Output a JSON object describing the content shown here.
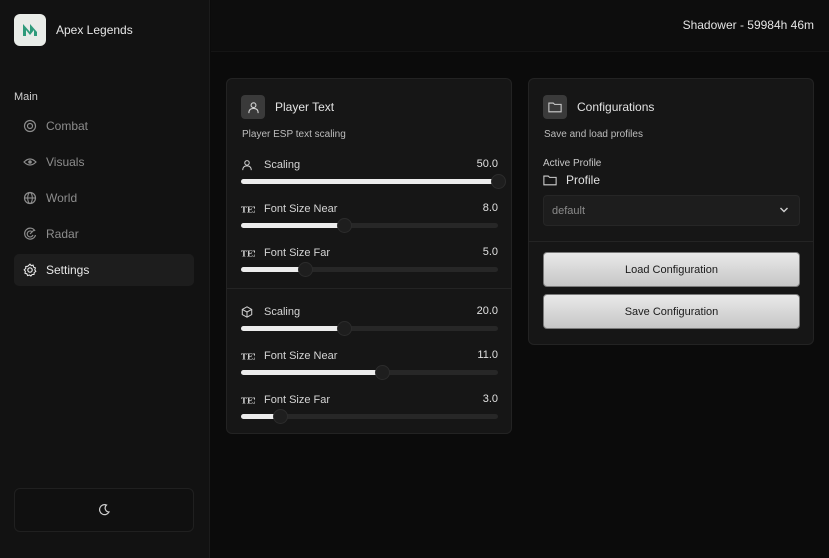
{
  "app": {
    "title": "Apex Legends"
  },
  "user_status": "Shadower - 59984h 46m",
  "sidebar": {
    "section_label": "Main",
    "items": [
      {
        "label": "Combat",
        "icon": "target-icon",
        "active": false
      },
      {
        "label": "Visuals",
        "icon": "eye-icon",
        "active": false
      },
      {
        "label": "World",
        "icon": "globe-icon",
        "active": false
      },
      {
        "label": "Radar",
        "icon": "radar-icon",
        "active": false
      },
      {
        "label": "Settings",
        "icon": "gear-icon",
        "active": true
      }
    ],
    "theme_toggle_icon": "moon-icon"
  },
  "player_text": {
    "title": "Player Text",
    "subtitle": "Player ESP text scaling",
    "groups": [
      {
        "icon": "user-icon",
        "sliders": [
          {
            "label": "Scaling",
            "value": "50.0",
            "fraction": 1.0,
            "icon": "user-icon"
          },
          {
            "label": "Font Size Near",
            "value": "8.0",
            "fraction": 0.4,
            "icon": "tex-icon"
          },
          {
            "label": "Font Size Far",
            "value": "5.0",
            "fraction": 0.25,
            "icon": "tex-icon"
          }
        ]
      },
      {
        "icon": "cube-icon",
        "sliders": [
          {
            "label": "Scaling",
            "value": "20.0",
            "fraction": 0.4,
            "icon": "cube-icon"
          },
          {
            "label": "Font Size Near",
            "value": "11.0",
            "fraction": 0.55,
            "icon": "tex-icon"
          },
          {
            "label": "Font Size Far",
            "value": "3.0",
            "fraction": 0.15,
            "icon": "tex-icon"
          }
        ]
      }
    ]
  },
  "configurations": {
    "title": "Configurations",
    "subtitle": "Save and load profiles",
    "active_profile_label": "Active Profile",
    "profile_label": "Profile",
    "selected_profile": "default",
    "load_button": "Load Configuration",
    "save_button": "Save Configuration"
  },
  "colors": {
    "background": "#0b0b0b",
    "panel": "#161616",
    "accent": "#ececec"
  }
}
